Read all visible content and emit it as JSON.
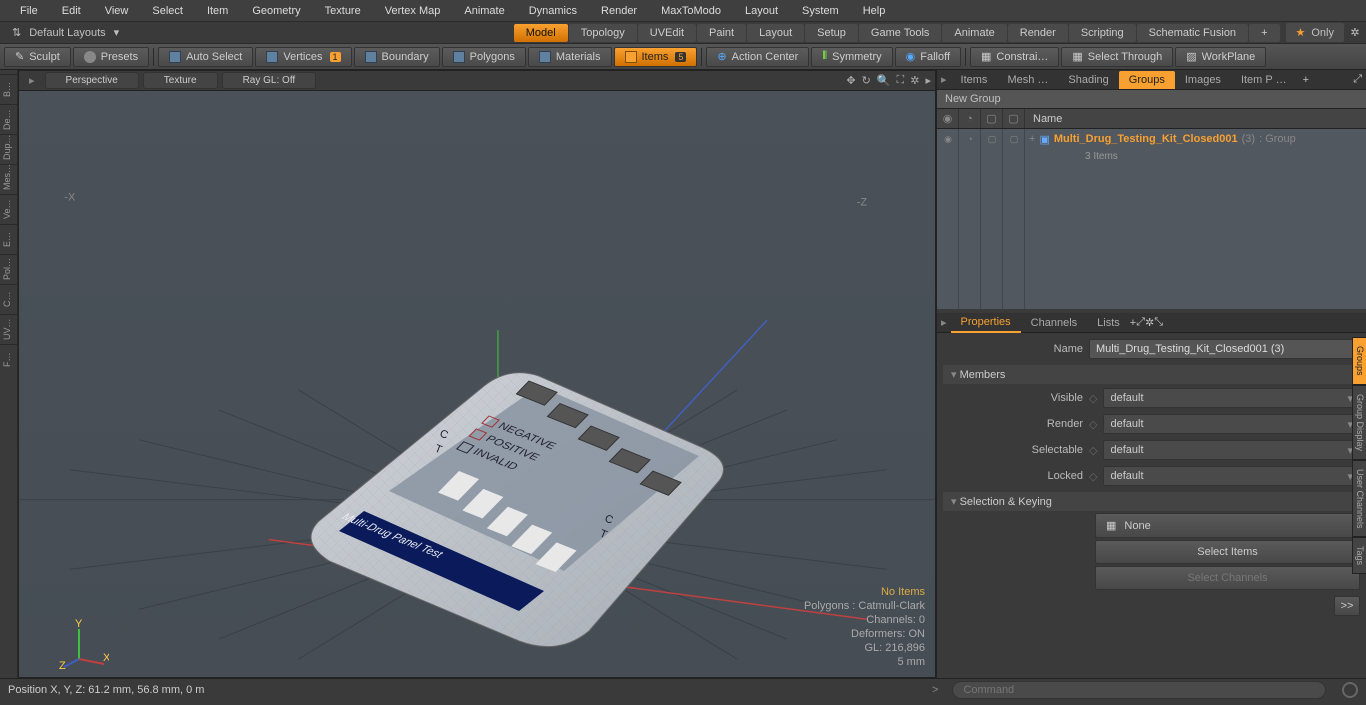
{
  "menu": [
    "File",
    "Edit",
    "View",
    "Select",
    "Item",
    "Geometry",
    "Texture",
    "Vertex Map",
    "Animate",
    "Dynamics",
    "Render",
    "MaxToModo",
    "Layout",
    "System",
    "Help"
  ],
  "layout_label": "Default Layouts",
  "workspace_tabs": [
    {
      "label": "Model",
      "active": true
    },
    {
      "label": "Topology"
    },
    {
      "label": "UVEdit"
    },
    {
      "label": "Paint"
    },
    {
      "label": "Layout"
    },
    {
      "label": "Setup"
    },
    {
      "label": "Game Tools"
    },
    {
      "label": "Animate"
    },
    {
      "label": "Render"
    },
    {
      "label": "Scripting"
    },
    {
      "label": "Schematic Fusion"
    }
  ],
  "only_label": "Only",
  "toolbar": {
    "sculpt": "Sculpt",
    "presets": "Presets",
    "auto_select": "Auto Select",
    "vertices": "Vertices",
    "vertices_count": "1",
    "boundary": "Boundary",
    "polygons": "Polygons",
    "materials": "Materials",
    "items": "Items",
    "items_count": "5",
    "action_center": "Action Center",
    "symmetry": "Symmetry",
    "falloff": "Falloff",
    "constrai": "Constrai…",
    "select_through": "Select Through",
    "workplane": "WorkPlane"
  },
  "left_tabs": [
    "B…",
    "De…",
    "Dup…",
    "Mes…",
    "Ve…",
    "E…",
    "Pol…",
    "C…",
    "UV…",
    "F…"
  ],
  "viewport": {
    "pills": [
      "Perspective",
      "Texture",
      "Ray GL: Off"
    ],
    "axis_neg_x": "-X",
    "axis_neg_z": "-Z",
    "status_no_items": "No Items",
    "status_polygons": "Polygons : Catmull-Clark",
    "status_channels": "Channels: 0",
    "status_deformers": "Deformers: ON",
    "status_gl": "GL: 216,896",
    "status_size": "5 mm",
    "model_title": "Multi-Drug Panel Test",
    "legend_neg": "NEGATIVE",
    "legend_pos": "POSITIVE",
    "legend_inv": "INVALID",
    "mark_c": "C",
    "mark_t": "T",
    "gizmo_x": "X",
    "gizmo_y": "Y",
    "gizmo_z": "Z"
  },
  "right": {
    "top_tabs": [
      "Items",
      "Mesh  …",
      "Shading",
      "Groups",
      "Images",
      "Item P …"
    ],
    "top_active": 3,
    "new_group": "New Group",
    "col_name": "Name",
    "tree_name": "Multi_Drug_Testing_Kit_Closed001",
    "tree_suffix": "(3)",
    "tree_type": ": Group",
    "tree_count": "3 Items",
    "prop_tabs": [
      "Properties",
      "Channels",
      "Lists"
    ],
    "prop_active": 0,
    "name_label": "Name",
    "name_value": "Multi_Drug_Testing_Kit_Closed001 (3)",
    "members": "Members",
    "visible": "Visible",
    "render": "Render",
    "selectable": "Selectable",
    "locked": "Locked",
    "default": "default",
    "sel_key": "Selection & Keying",
    "none": "None",
    "select_items": "Select Items",
    "select_channels": "Select Channels",
    "side_tabs": [
      "Groups",
      "Group Display",
      "User Channels",
      "Tags"
    ],
    "arrow": ">>"
  },
  "status": {
    "pos": "Position X, Y, Z:   61.2 mm, 56.8 mm, 0 m",
    "cmd_placeholder": "Command"
  }
}
